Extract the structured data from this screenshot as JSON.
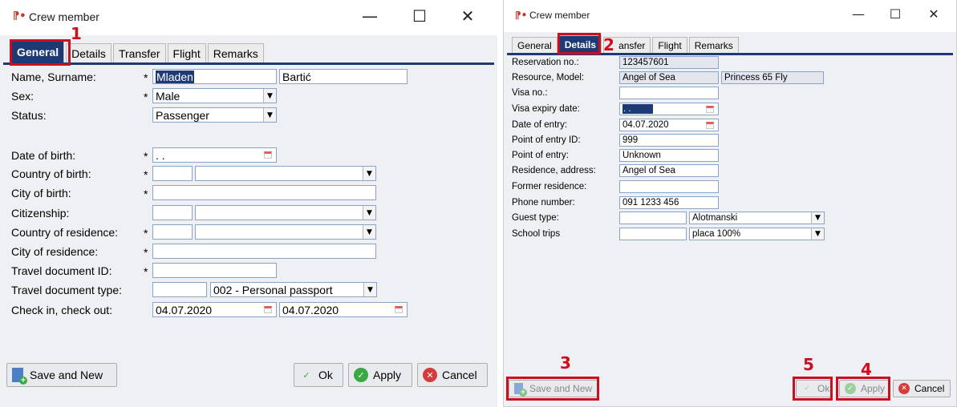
{
  "left": {
    "window_title": "Crew member",
    "tabs": [
      "General",
      "Details",
      "Transfer",
      "Flight",
      "Remarks"
    ],
    "labels": {
      "name": "Name, Surname:",
      "sex": "Sex:",
      "status": "Status:",
      "dob": "Date of birth:",
      "country_birth": "Country of birth:",
      "city_birth": "City of birth:",
      "citizenship": "Citizenship:",
      "country_res": "Country of residence:",
      "city_res": "City of residence:",
      "doc_id": "Travel document ID:",
      "doc_type": "Travel document type:",
      "checkin": "Check in, check out:"
    },
    "required_mark": "*",
    "values": {
      "first_name": "Mladen",
      "surname": "Bartić",
      "sex": "Male",
      "status": "Passenger",
      "dob": " .  .",
      "doc_type": "002 - Personal passport",
      "check_in": "04.07.2020",
      "check_out": "04.07.2020"
    },
    "buttons": {
      "save_new": "Save and New",
      "ok": "Ok",
      "apply": "Apply",
      "cancel": "Cancel"
    }
  },
  "right": {
    "window_title": "Crew member",
    "tabs": [
      "General",
      "Details",
      "ansfer",
      "Flight",
      "Remarks"
    ],
    "labels": {
      "reservation": "Reservation no.:",
      "resource": "Resource, Model:",
      "visa_no": "Visa no.:",
      "visa_exp": "Visa expiry date:",
      "entry_date": "Date of entry:",
      "entry_id": "Point of entry ID:",
      "entry_point": "Point of entry:",
      "residence": "Residence, address:",
      "former": "Former residence:",
      "phone": "Phone number:",
      "guest_type": "Guest type:",
      "school": "School trips"
    },
    "values": {
      "reservation": "123457601",
      "resource": "Angel of Sea",
      "model": "Princess 65 Fly",
      "visa_exp": " .  .",
      "entry_date": "04.07.2020",
      "entry_id": "999",
      "entry_point": "Unknown",
      "residence": "Angel of Sea",
      "phone": "091 1233 456",
      "guest_type": "Alotmanski",
      "school": "placa 100%"
    },
    "buttons": {
      "save_new": "Save and New",
      "ok": "Ok",
      "apply": "Apply",
      "cancel": "Cancel"
    }
  },
  "annotations": [
    "1",
    "2",
    "3",
    "4",
    "5"
  ],
  "colors": {
    "highlight": "#cc0f1f",
    "tab_active": "#1e3a75",
    "client_bg": "#eef0f4"
  }
}
